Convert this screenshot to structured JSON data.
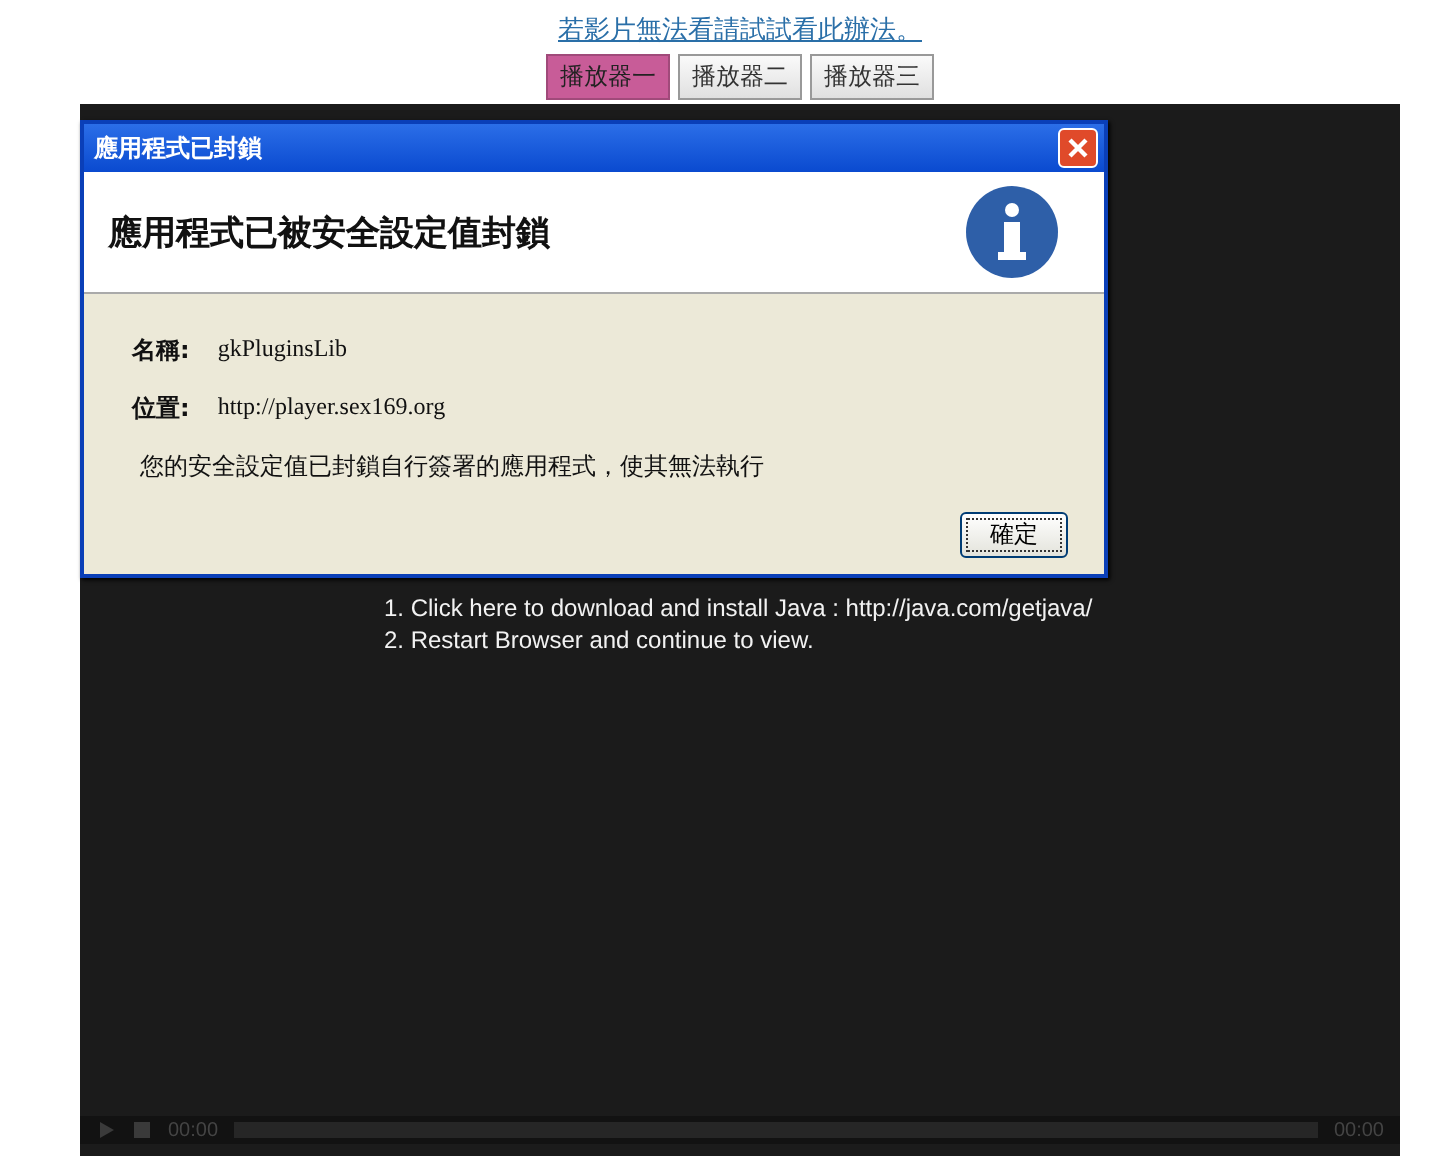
{
  "help_link": "若影片無法看請試試看此辦法。",
  "player_tabs": [
    {
      "label": "播放器一",
      "selected": true
    },
    {
      "label": "播放器二",
      "selected": false
    },
    {
      "label": "播放器三",
      "selected": false
    }
  ],
  "player": {
    "instructions": [
      "1. Click here to download and install Java : http://java.com/getjava/",
      "2. Restart Browser and continue to view."
    ],
    "controls": {
      "elapsed": "00:00",
      "duration": "00:00"
    }
  },
  "dialog": {
    "title": "應用程式已封鎖",
    "heading": "應用程式已被安全設定值封鎖",
    "fields": [
      {
        "label": "名稱:",
        "value": "gkPluginsLib"
      },
      {
        "label": "位置:",
        "value": "http://player.sex169.org"
      }
    ],
    "message": "您的安全設定值已封鎖自行簽署的應用程式，使其無法執行",
    "button": "確定"
  }
}
